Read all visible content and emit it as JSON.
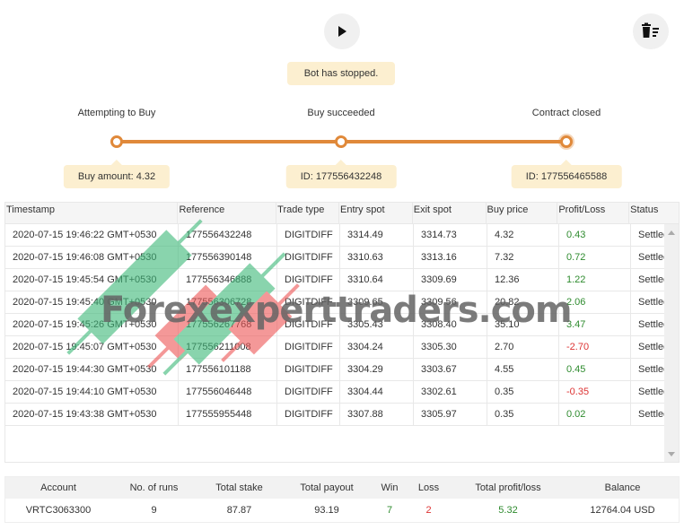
{
  "toolbar": {
    "run_icon": "play-icon",
    "clear_icon": "trash-list-icon"
  },
  "status_toast": "Bot has stopped.",
  "progress": {
    "steps": [
      {
        "label": "Attempting to Buy",
        "detail": "Buy amount: 4.32"
      },
      {
        "label": "Buy succeeded",
        "detail": "ID: 177556432248"
      },
      {
        "label": "Contract closed",
        "detail": "ID: 177556465588"
      }
    ],
    "accent": "#e0893a"
  },
  "log_table": {
    "columns": [
      "Timestamp",
      "Reference",
      "Trade type",
      "Entry spot",
      "Exit spot",
      "Buy price",
      "Profit/Loss",
      "Status"
    ],
    "rows": [
      {
        "timestamp": "2020-07-15 19:46:22 GMT+0530",
        "reference": "177556432248",
        "trade_type": "DIGITDIFF",
        "entry_spot": "3314.49",
        "exit_spot": "3314.73",
        "buy_price": "4.32",
        "profit_loss": "0.43",
        "status": "Settled"
      },
      {
        "timestamp": "2020-07-15 19:46:08 GMT+0530",
        "reference": "177556390148",
        "trade_type": "DIGITDIFF",
        "entry_spot": "3310.63",
        "exit_spot": "3313.16",
        "buy_price": "7.32",
        "profit_loss": "0.72",
        "status": "Settled"
      },
      {
        "timestamp": "2020-07-15 19:45:54 GMT+0530",
        "reference": "177556346888",
        "trade_type": "DIGITDIFF",
        "entry_spot": "3310.64",
        "exit_spot": "3309.69",
        "buy_price": "12.36",
        "profit_loss": "1.22",
        "status": "Settled"
      },
      {
        "timestamp": "2020-07-15 19:45:40 GMT+0530",
        "reference": "177556306728",
        "trade_type": "DIGITDIFF",
        "entry_spot": "3309.65",
        "exit_spot": "3309.56",
        "buy_price": "20.82",
        "profit_loss": "2.06",
        "status": "Settled"
      },
      {
        "timestamp": "2020-07-15 19:45:26 GMT+0530",
        "reference": "177556267768",
        "trade_type": "DIGITDIFF",
        "entry_spot": "3305.43",
        "exit_spot": "3308.40",
        "buy_price": "35.10",
        "profit_loss": "3.47",
        "status": "Settled"
      },
      {
        "timestamp": "2020-07-15 19:45:07 GMT+0530",
        "reference": "177556211008",
        "trade_type": "DIGITDIFF",
        "entry_spot": "3304.24",
        "exit_spot": "3305.30",
        "buy_price": "2.70",
        "profit_loss": "-2.70",
        "status": "Settled"
      },
      {
        "timestamp": "2020-07-15 19:44:30 GMT+0530",
        "reference": "177556101188",
        "trade_type": "DIGITDIFF",
        "entry_spot": "3304.29",
        "exit_spot": "3303.67",
        "buy_price": "4.55",
        "profit_loss": "0.45",
        "status": "Settled"
      },
      {
        "timestamp": "2020-07-15 19:44:10 GMT+0530",
        "reference": "177556046448",
        "trade_type": "DIGITDIFF",
        "entry_spot": "3304.44",
        "exit_spot": "3302.61",
        "buy_price": "0.35",
        "profit_loss": "-0.35",
        "status": "Settled"
      },
      {
        "timestamp": "2020-07-15 19:43:38 GMT+0530",
        "reference": "177555955448",
        "trade_type": "DIGITDIFF",
        "entry_spot": "3307.88",
        "exit_spot": "3305.97",
        "buy_price": "0.35",
        "profit_loss": "0.02",
        "status": "Settled"
      }
    ],
    "profit_color": "#2e8b2e",
    "loss_color": "#dd3333"
  },
  "summary": {
    "columns": [
      "Account",
      "No. of runs",
      "Total stake",
      "Total payout",
      "Win",
      "Loss",
      "Total profit/loss",
      "Balance"
    ],
    "values": [
      "VRTC3063300",
      "9",
      "87.87",
      "93.19",
      "7",
      "2",
      "5.32",
      "12764.04 USD"
    ]
  },
  "watermark": "Forexexperttraders.com"
}
